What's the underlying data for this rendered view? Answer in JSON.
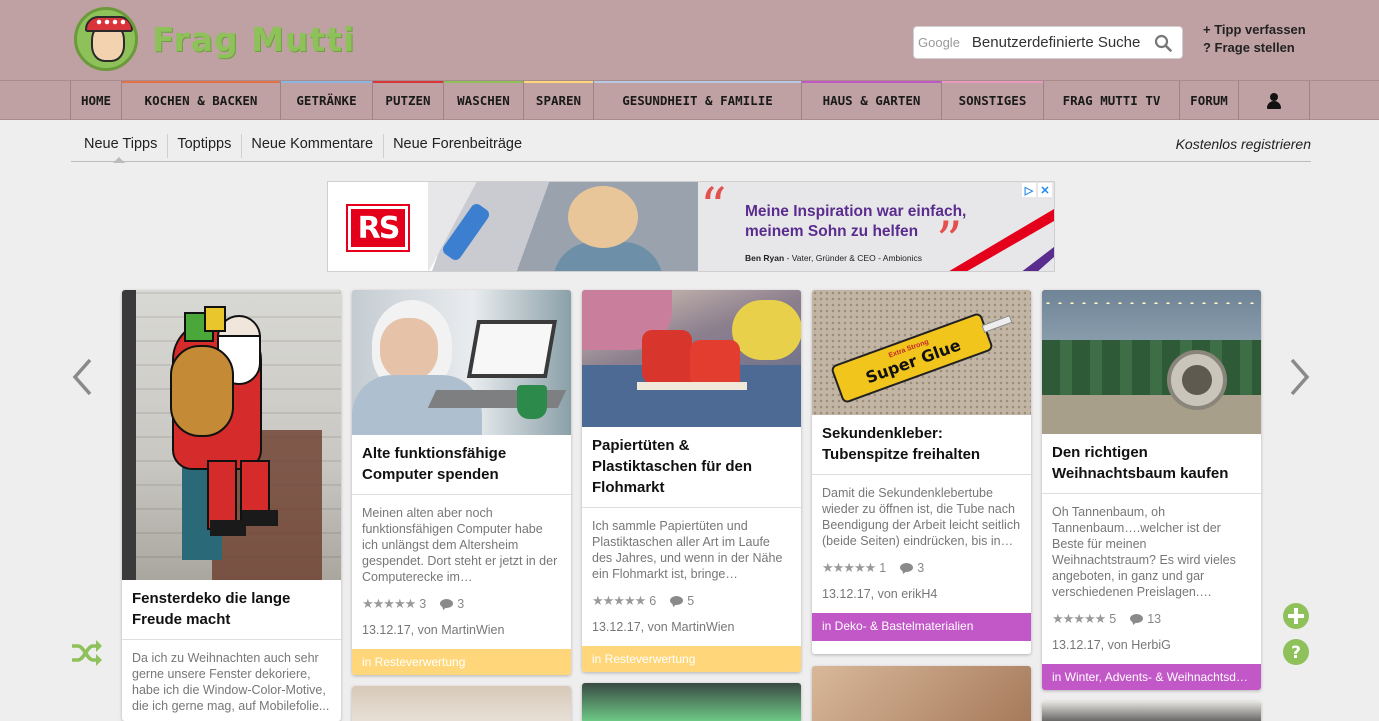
{
  "header": {
    "logo_text": "Frag Mutti",
    "search_brand": "Google",
    "search_placeholder": "Benutzerdefinierte Suche",
    "links": [
      "+ Tipp verfassen",
      "? Frage stellen"
    ]
  },
  "nav": {
    "items": [
      {
        "label": "HOME",
        "color": "#bfa1a3"
      },
      {
        "label": "KOCHEN & BACKEN",
        "color": "#e4704a"
      },
      {
        "label": "GETRÄNKE",
        "color": "#8ab6e0"
      },
      {
        "label": "PUTZEN",
        "color": "#d9343a"
      },
      {
        "label": "WASCHEN",
        "color": "#8fc15a"
      },
      {
        "label": "SPAREN",
        "color": "#ffd77a"
      },
      {
        "label": "GESUNDHEIT & FAMILIE",
        "color": "#b7c9e2"
      },
      {
        "label": "HAUS & GARTEN",
        "color": "#c257c8"
      },
      {
        "label": "SONSTIGES",
        "color": "#e89ac0"
      },
      {
        "label": "FRAG MUTTI TV",
        "color": "#bfa1a3"
      },
      {
        "label": "FORUM",
        "color": "#bfa1a3"
      }
    ]
  },
  "subnav": {
    "tabs": [
      "Neue Tipps",
      "Toptipps",
      "Neue Kommentare",
      "Neue Forenbeiträge"
    ],
    "register": "Kostenlos registrieren"
  },
  "ad": {
    "logo": "RS",
    "headline_line1": "Meine Inspiration war einfach,",
    "headline_line2": "meinem Sohn zu helfen",
    "byline_name": "Ben Ryan",
    "byline_rest": " - Vater, Gründer & CEO - Ambionics",
    "badge_info": "▷",
    "badge_close": "✕"
  },
  "cards": [
    {
      "title": "Fensterdeko die lange Freude macht",
      "text": "Da ich zu Weihnachten auch sehr gerne unsere Fenster dekoriere, habe ich die Window-Color-Motive, die ich gerne mag, auf Mobilefolie..."
    },
    {
      "title": "Alte funktionsfähige Computer spenden",
      "text": "Meinen alten aber noch funktionsfähigen Computer habe ich unlängst dem Altersheim gespendet. Dort steht er jetzt in der Computerecke im…",
      "stars": "★★★★★",
      "rating": "3",
      "comments": "3",
      "date": "13.12.17, von MartinWien",
      "category": "in Resteverwertung"
    },
    {
      "title": "Papiertüten & Plastiktaschen für den Flohmarkt",
      "text": "Ich sammle Papiertüten und Plastiktaschen aller Art im Laufe des Jahres, und wenn in der Nähe ein Flohmarkt ist, bringe…",
      "stars": "★★★★★",
      "rating": "6",
      "comments": "5",
      "date": "13.12.17, von MartinWien",
      "category": "in Resteverwertung"
    },
    {
      "title": "Sekundenkleber: Tubenspitze freihalten",
      "text": "Damit die Sekundenklebertube wieder zu öffnen ist, die Tube nach Beendigung der Arbeit leicht seitlich (beide Seiten) eindrücken, bis in…",
      "stars": "★★★★★",
      "rating": "1",
      "comments": "3",
      "date": "13.12.17, von erikH4",
      "category": "in Deko- & Bastelmaterialien",
      "glue_text": "Super Glue",
      "glue_small": "Extra Strong"
    },
    {
      "title": "Den richtigen Weihnachtsbaum kaufen",
      "text": "Oh Tannenbaum, oh Tannenbaum….welcher ist der Beste für meinen Weihnachtstraum? Es wird vieles angeboten, in ganz und gar verschiedenen Preislagen.…",
      "stars": "★★★★★",
      "rating": "5",
      "comments": "13",
      "date": "13.12.17, von HerbiG",
      "category": "in Winter, Advents- & Weihnachtsd…"
    }
  ]
}
